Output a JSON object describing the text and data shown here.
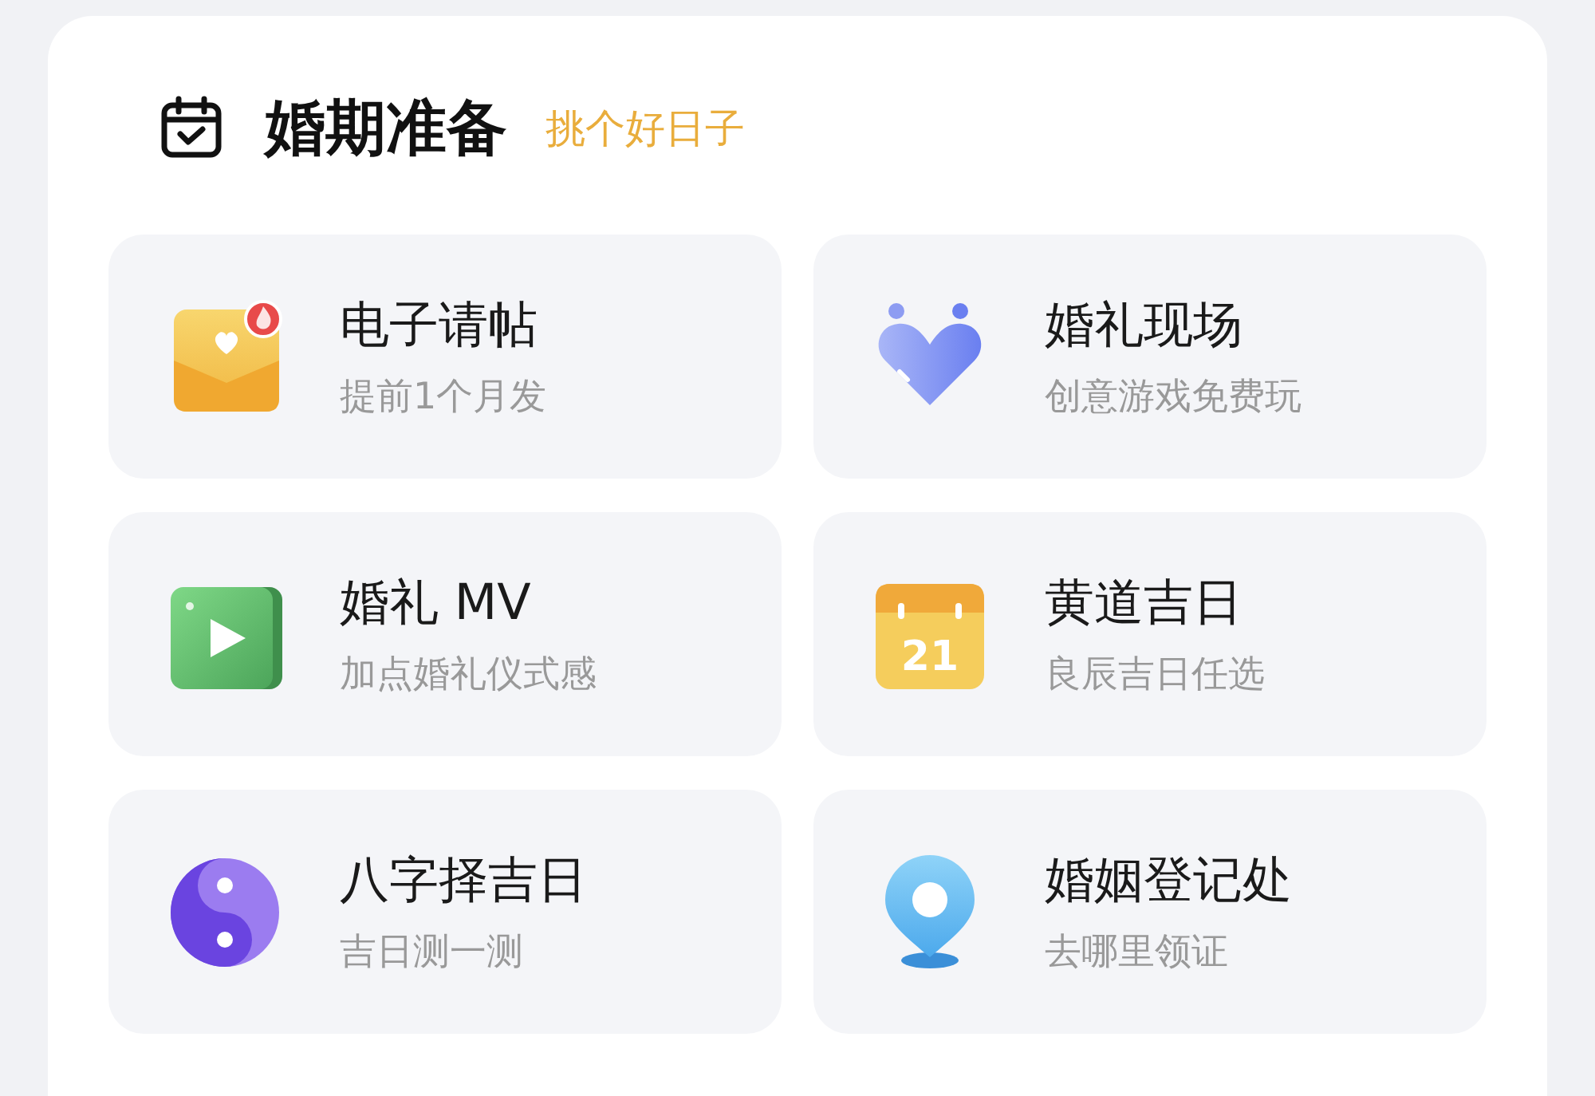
{
  "header": {
    "title": "婚期准备",
    "subtitle": "挑个好日子"
  },
  "items": [
    {
      "kind": "envelope",
      "title": "电子请帖",
      "subtitle": "提前1个月发"
    },
    {
      "kind": "heart",
      "title": "婚礼现场",
      "subtitle": "创意游戏免费玩"
    },
    {
      "kind": "video",
      "title": "婚礼 MV",
      "subtitle": "加点婚礼仪式感"
    },
    {
      "kind": "calendar",
      "title": "黄道吉日",
      "subtitle": "良辰吉日任选",
      "icon_text": "21"
    },
    {
      "kind": "taiji",
      "title": "八字择吉日",
      "subtitle": "吉日测一测"
    },
    {
      "kind": "pin",
      "title": "婚姻登记处",
      "subtitle": "去哪里领证"
    }
  ]
}
